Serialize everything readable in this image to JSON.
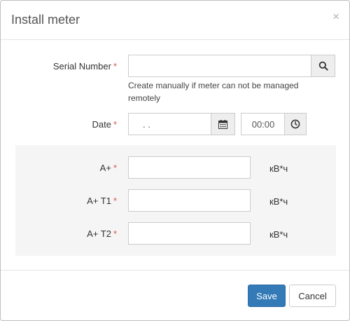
{
  "dialog": {
    "title": "Install meter",
    "close_symbol": "×"
  },
  "form": {
    "serial": {
      "label": "Serial Number",
      "required_mark": "*",
      "value": "",
      "help": "Create manually if meter can not be managed remotely",
      "search_icon": "search-icon"
    },
    "date": {
      "label": "Date",
      "required_mark": "*",
      "value": ". .",
      "calendar_icon": "calendar-icon",
      "time_value": "00:00",
      "clock_icon": "clock-icon"
    },
    "readings": [
      {
        "label": "A+",
        "required_mark": "*",
        "value": "",
        "unit": "кВ*ч"
      },
      {
        "label": "A+ T1",
        "required_mark": "*",
        "value": "",
        "unit": "кВ*ч"
      },
      {
        "label": "A+ T2",
        "required_mark": "*",
        "value": "",
        "unit": "кВ*ч"
      }
    ]
  },
  "footer": {
    "save_label": "Save",
    "cancel_label": "Cancel"
  },
  "colors": {
    "primary": "#337ab7",
    "required": "#d9534f",
    "panel_bg": "#f5f5f5"
  }
}
